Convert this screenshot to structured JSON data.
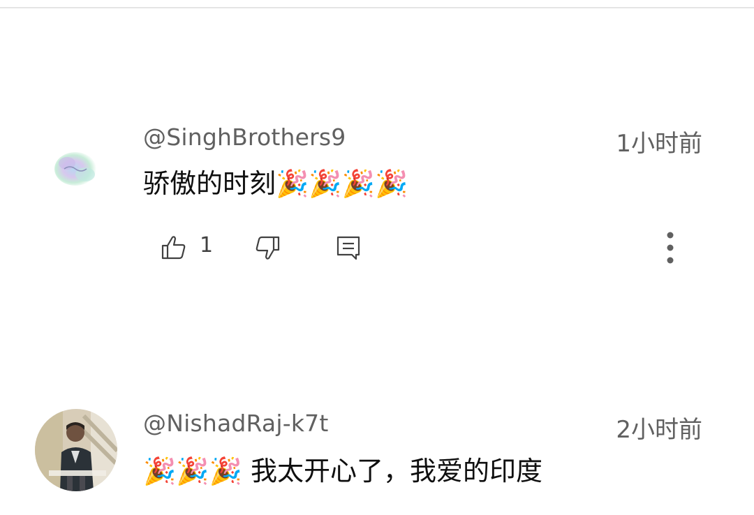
{
  "comments": [
    {
      "handle": "@SinghBrothers9",
      "time": "1小时前",
      "text": "骄傲的时刻",
      "emojis": "🎉🎉🎉🎉",
      "likes": "1",
      "avatar_icon": "watercolor-logo-avatar"
    },
    {
      "handle": "@NishadRaj-k7t",
      "time": "2小时前",
      "emojis": "🎉🎉🎉",
      "text": " 我太开心了，我爱的印度",
      "avatar_icon": "person-photo-avatar"
    }
  ],
  "colors": {
    "meta_text": "#606060",
    "body_text": "#0f0f0f",
    "icon": "#404040",
    "divider": "#e5e5e5"
  }
}
